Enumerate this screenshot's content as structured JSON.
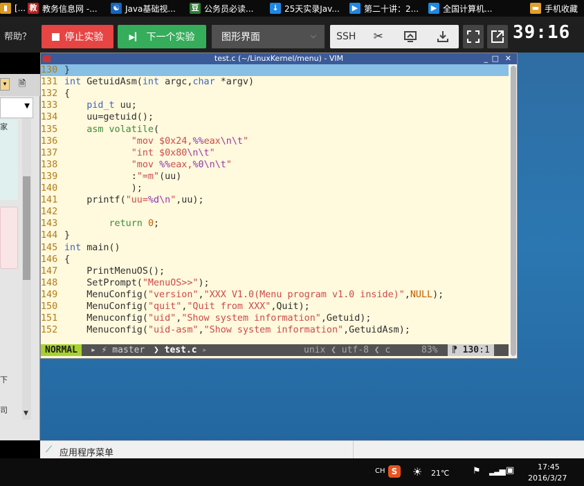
{
  "bookmarks": [
    {
      "label": "[...",
      "icon": "▮",
      "color": "#d89a21"
    },
    {
      "label": "教务信息网 -...",
      "icon": "教",
      "color": "#b22222"
    },
    {
      "label": "Java基础视...",
      "icon": "☯",
      "color": "#1565c0"
    },
    {
      "label": "公务员必读...",
      "icon": "豆",
      "color": "#2e7d32"
    },
    {
      "label": "25天实录Jav...",
      "icon": "↓",
      "color": "#1e88e5"
    },
    {
      "label": "第二十讲：2...",
      "icon": "▶",
      "color": "#1e88e5"
    },
    {
      "label": "全国计算机...",
      "icon": "▶",
      "color": "#1e88e5"
    },
    {
      "label": "手机收藏",
      "icon": "▬",
      "color": "#e0a030"
    }
  ],
  "toolbar": {
    "help": "帮助？",
    "stop": "停止实验",
    "next": "下一个实验",
    "interface": "图形界面",
    "ssh": "SSH",
    "timer": "39:16",
    "stop_icon": "square-icon",
    "next_icon": "skip-icon",
    "scissors_icon": "scissors-icon",
    "screen_icon": "screen-share-icon",
    "download_icon": "download-icon",
    "fullscreen_icon": "fullscreen-icon",
    "popout_icon": "popout-icon"
  },
  "left_panel": {
    "frag1": "家",
    "frag2": "下",
    "frag3": "司"
  },
  "vim": {
    "title": "test.c (~/LinuxKernel/menu) - VIM",
    "lines": [
      {
        "n": "130",
        "t": "}"
      },
      {
        "n": "131",
        "t": "int GetuidAsm(int argc,char *argv)"
      },
      {
        "n": "132",
        "t": "{"
      },
      {
        "n": "133",
        "t": "    pid_t uu;"
      },
      {
        "n": "134",
        "t": "    uu=getuid();"
      },
      {
        "n": "135",
        "t": "    asm volatile("
      },
      {
        "n": "136",
        "t": "            \"mov $0x24,%%eax\\n\\t\""
      },
      {
        "n": "137",
        "t": "            \"int $0x80\\n\\t\""
      },
      {
        "n": "138",
        "t": "            \"mov %%eax,%0\\n\\t\""
      },
      {
        "n": "139",
        "t": "            :\"=m\"(uu)"
      },
      {
        "n": "140",
        "t": "            );"
      },
      {
        "n": "141",
        "t": "    printf(\"uu=%d\\n\",uu);"
      },
      {
        "n": "142",
        "t": ""
      },
      {
        "n": "143",
        "t": "        return 0;"
      },
      {
        "n": "144",
        "t": "}"
      },
      {
        "n": "145",
        "t": "int main()"
      },
      {
        "n": "146",
        "t": "{"
      },
      {
        "n": "147",
        "t": "    PrintMenuOS();"
      },
      {
        "n": "148",
        "t": "    SetPrompt(\"MenuOS>>\");"
      },
      {
        "n": "149",
        "t": "    MenuConfig(\"version\",\"XXX V1.0(Menu program v1.0 inside)\",NULL);"
      },
      {
        "n": "150",
        "t": "    MenuConfig(\"quit\",\"Quit from XXX\",Quit);"
      },
      {
        "n": "151",
        "t": "    Menuconfig(\"uid\",\"Show system information\",Getuid);"
      },
      {
        "n": "152",
        "t": "    Menuconfig(\"uid-asm\",\"Show system information\",GetuidAsm);"
      }
    ],
    "status": {
      "mode": "NORMAL",
      "branch": "master",
      "file": "test.c",
      "format": "unix",
      "encoding": "utf-8",
      "filetype": "c",
      "percent": "83%",
      "line": "130",
      "col": ":1"
    }
  },
  "appmenu": {
    "label": "应用程序菜单"
  },
  "taskbar": {
    "ime": "CH",
    "sogou": "S",
    "temp": "21℃",
    "time": "17:45",
    "date": "2016/3/27"
  }
}
